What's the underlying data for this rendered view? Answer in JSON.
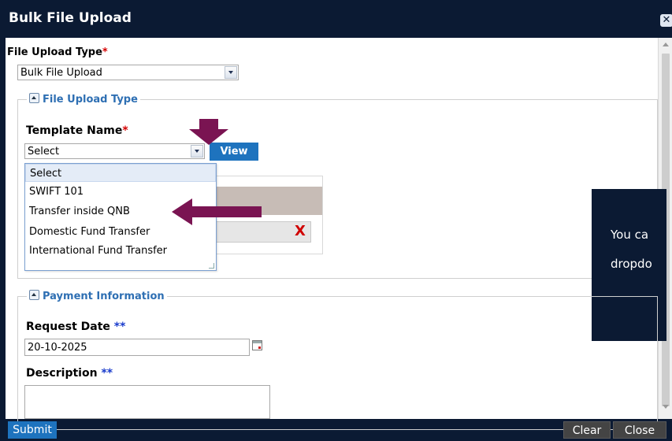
{
  "dialog": {
    "title": "Bulk File Upload",
    "close_icon": "close-icon"
  },
  "upload_type": {
    "label": "File Upload Type",
    "required_mark": "*",
    "selected": "Bulk File Upload"
  },
  "file_section": {
    "legend": "File Upload Type",
    "template_label": "Template Name",
    "template_required_mark": "*",
    "template_selected": "Select",
    "view_button": "View",
    "options": [
      "Select",
      "SWIFT 101",
      "Transfer inside QNB",
      "Domestic Fund Transfer",
      "International Fund Transfer"
    ],
    "highlighted_option": "Select"
  },
  "payment_section": {
    "legend": "Payment Information",
    "request_date_label": "Request Date",
    "request_date_mark": "**",
    "request_date_value": "20-10-2025",
    "description_label": "Description",
    "description_mark": "**",
    "description_value": ""
  },
  "tooltip": {
    "line1": "You ca",
    "line2": "dropdo"
  },
  "footer": {
    "submit": "Submit",
    "clear": "Clear",
    "close": "Close"
  },
  "colors": {
    "titlebar": "#0b1a33",
    "primary_button": "#1e73be",
    "secondary_button": "#444444",
    "required_red": "#d40000",
    "required_blue": "#1a3ccc",
    "legend_text": "#2e6fb3",
    "annotation_arrow": "#7a1452"
  },
  "icons": {
    "dropdown_caret": "chevron-down-icon",
    "collapse": "collapse-triangle-icon",
    "calendar": "calendar-icon",
    "remove": "remove-x-icon",
    "annotation_arrow": "arrow-annotation-icon"
  }
}
